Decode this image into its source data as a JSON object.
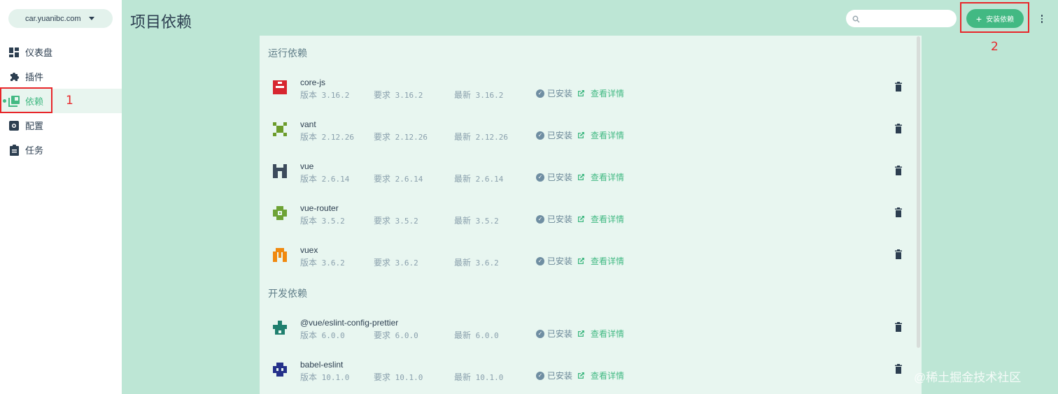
{
  "sidebar": {
    "project": "car.yuanibc.com",
    "items": [
      {
        "label": "仪表盘",
        "icon": "dashboard-icon"
      },
      {
        "label": "插件",
        "icon": "puzzle-icon"
      },
      {
        "label": "依赖",
        "icon": "library-icon",
        "active": true
      },
      {
        "label": "配置",
        "icon": "settings-icon"
      },
      {
        "label": "任务",
        "icon": "clipboard-icon"
      }
    ]
  },
  "header": {
    "title": "项目依赖",
    "search_placeholder": "",
    "install_label": "安装依赖"
  },
  "annotations": {
    "one": "1",
    "two": "2"
  },
  "sections": {
    "runtime": "运行依赖",
    "dev": "开发依赖"
  },
  "labels": {
    "version": "版本",
    "required": "要求",
    "latest": "最新",
    "installed": "已安装",
    "details": "查看详情"
  },
  "dependencies": [
    {
      "name": "core-js",
      "version": "3.16.2",
      "required": "3.16.2",
      "latest": "3.16.2",
      "color": "#d7262f"
    },
    {
      "name": "vant",
      "version": "2.12.26",
      "required": "2.12.26",
      "latest": "2.12.26",
      "color": "#6b9c2a"
    },
    {
      "name": "vue",
      "version": "2.6.14",
      "required": "2.6.14",
      "latest": "2.6.14",
      "color": "#3c4b5c"
    },
    {
      "name": "vue-router",
      "version": "3.5.2",
      "required": "3.5.2",
      "latest": "3.5.2",
      "color": "#6da335"
    },
    {
      "name": "vuex",
      "version": "3.6.2",
      "required": "3.6.2",
      "latest": "3.6.2",
      "color": "#f0890f"
    },
    {
      "name": "@vue/eslint-config-prettier",
      "version": "6.0.0",
      "required": "6.0.0",
      "latest": "6.0.0",
      "color": "#1f7f6e"
    },
    {
      "name": "babel-eslint",
      "version": "10.1.0",
      "required": "10.1.0",
      "latest": "10.1.0",
      "color": "#24318a"
    }
  ],
  "watermark": "@稀土掘金技术社区"
}
